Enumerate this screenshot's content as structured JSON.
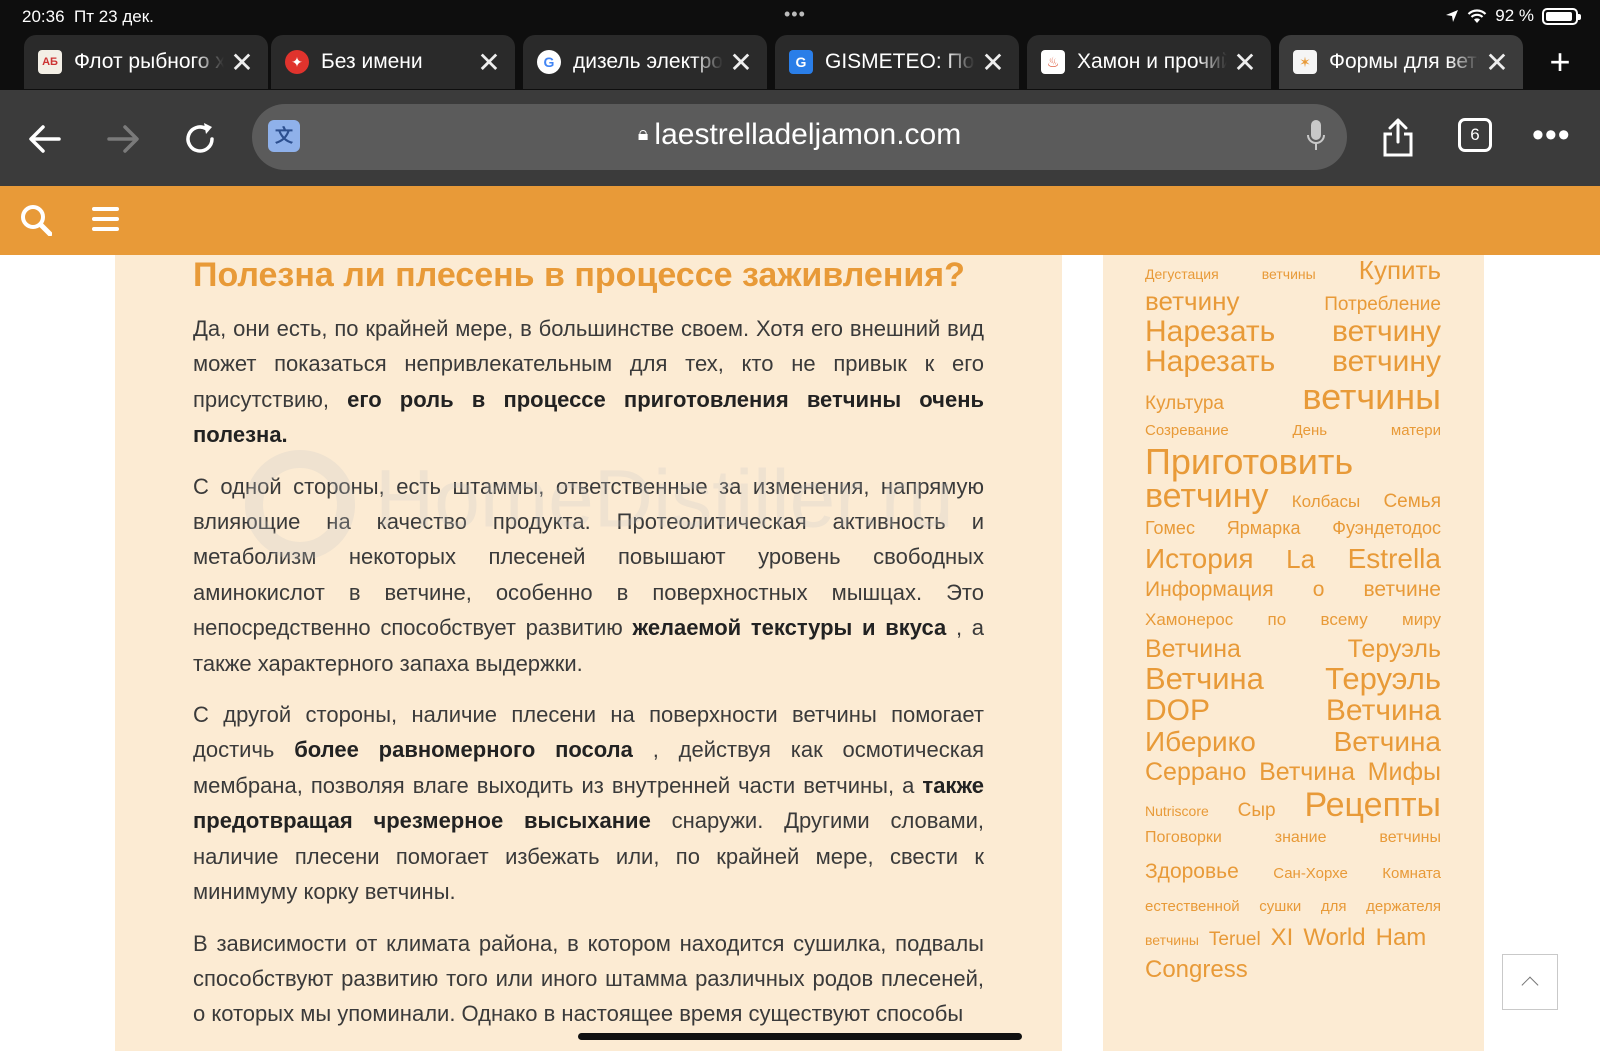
{
  "status": {
    "time": "20:36",
    "date": "Пт 23 дек.",
    "battery": "92 %",
    "battery_level": 0.92
  },
  "tabs": [
    {
      "title": "Флот рыбного хозяйства",
      "favicon": "abc-grid-icon",
      "active": false
    },
    {
      "title": "Без имени",
      "favicon": "red-star-icon",
      "active": false
    },
    {
      "title": "дизель электрох",
      "favicon": "google-icon",
      "active": false
    },
    {
      "title": "GISMETEO: Погода",
      "favicon": "gismeteo-icon",
      "active": false
    },
    {
      "title": "Хамон и прочий",
      "favicon": "ham-icon",
      "active": false
    },
    {
      "title": "Формы для ветчины",
      "favicon": "star-page-icon",
      "active": true
    }
  ],
  "toolbar": {
    "url": "laestrelladeljamon.com",
    "tab_count": "6"
  },
  "article": {
    "heading": "Полезна ли плесень в процессе заживления?",
    "p1": {
      "text1": "Да, они есть, по крайней мере, в большинстве своем. Хотя его внешний вид может показаться непривлекательным для тех, кто не привык к его присутствию, ",
      "bold1": "его роль в процессе приготовления ветчины очень полезна."
    },
    "p2": {
      "text1": "С одной стороны, есть штаммы, ответственные за изменения, напрямую влияющие на качество продукта. Протеолитическая активность и метаболизм некоторых плесеней повышают уровень свободных аминокислот в ветчине, особенно в поверхностных мышцах. Это непосредственно способствует развитию ",
      "bold1": "желаемой текстуры и вкуса",
      "text2": " , а также характерного запаха выдержки."
    },
    "p3": {
      "text1": "С другой стороны, наличие плесени на поверхности ветчины помогает достичь ",
      "bold1": "более равномерного посола",
      "text2": " , действуя как осмотическая мембрана, позволяя влаге выходить из внутренней части ветчины, а ",
      "bold2": "также предотвращая чрезмерное высыхание",
      "text3": " снаружи. Другими словами, наличие плесени помогает избежать или, по крайней мере, свести к минимуму корку ветчины."
    },
    "p4": {
      "text1": "В зависимости от климата района, в котором находится сушилка, подвалы способствуют развитию того или иного штамма различных родов плесеней, о которых мы упоминали. Однако в настоящее время существуют способы"
    }
  },
  "watermark": "HomeDistiller.ru",
  "tag_lines": [
    [
      "Дегустация",
      "ветчины",
      "Купить"
    ],
    [
      "ветчину",
      "Потребление"
    ],
    [
      "Нарезать",
      "ветчину"
    ],
    [
      "Нарезать",
      "ветчину"
    ],
    [
      "Культура",
      "ветчины"
    ],
    [
      "Созревание",
      "День",
      "матери"
    ],
    [
      "Приготовить"
    ],
    [
      "ветчину",
      "Колбасы",
      "Семья"
    ],
    [
      "Гомес",
      "Ярмарка",
      "Фуэндетодос"
    ],
    [
      "История",
      "La",
      "Estrella"
    ],
    [
      "Информация",
      "о",
      "ветчине"
    ],
    [
      "Хамонерос",
      "по",
      "всему",
      "миру"
    ],
    [
      "Ветчина",
      "Теруэль"
    ],
    [
      "Ветчина",
      "Теруэль"
    ],
    [
      "DOP",
      "Ветчина"
    ],
    [
      "Иберико",
      "Ветчина"
    ],
    [
      "Серрано",
      "Ветчина",
      "Мифы"
    ],
    [
      "Nutriscore",
      "Сыр",
      "Рецепты"
    ],
    [
      "Поговорки",
      "знание",
      "ветчины"
    ],
    [
      "Здоровье",
      "Сан-Хорхе",
      "Комната"
    ],
    [
      "естественной",
      "сушки",
      "для",
      "держателя"
    ],
    [
      "ветчины",
      "Teruel",
      "XI",
      "World",
      "Ham"
    ],
    [
      "Congress"
    ]
  ],
  "colors": {
    "accent": "#e89a38",
    "content_bg": "#fcebd3",
    "chrome_dark": "#0e0e0e",
    "toolbar": "#3b3b3b"
  }
}
